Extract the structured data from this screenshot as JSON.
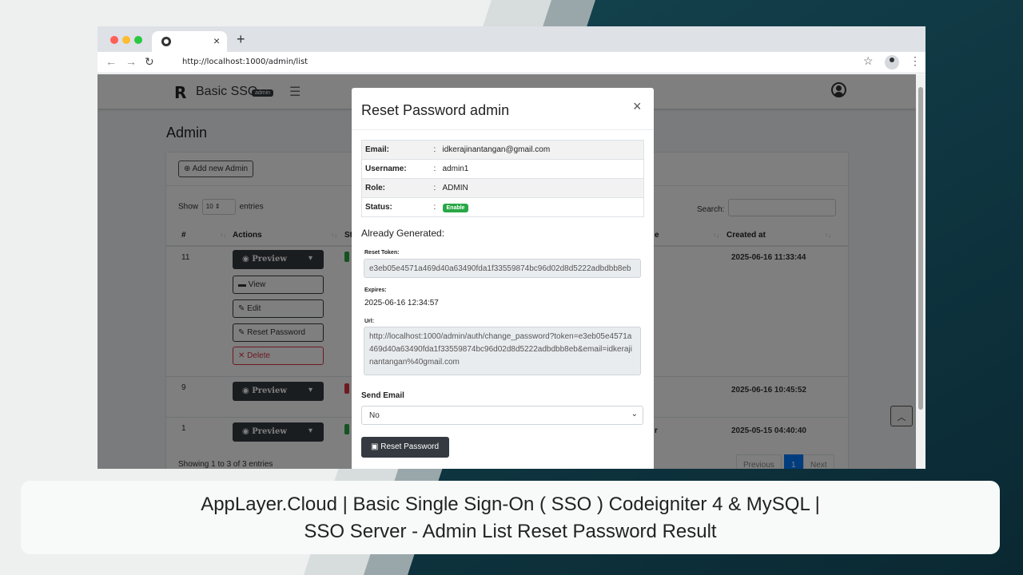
{
  "colors": {
    "accent": "#007bff",
    "dark_button": "#343a40",
    "success": "#28a745",
    "danger": "#dc3545"
  },
  "browser": {
    "url": "http://localhost:1000/admin/list",
    "tab_close": "×",
    "new_tab": "+",
    "icons": [
      "back-icon",
      "forward-icon",
      "reload-icon",
      "star-icon",
      "profile-icon",
      "menu-icon"
    ]
  },
  "app": {
    "brand_logo": "R",
    "brand": "Basic SSO",
    "brand_badge": "admin",
    "page_title": "Admin",
    "add_button": "Add new Admin",
    "show_label": "Show",
    "show_value": "10",
    "entries_label": "entries",
    "search_label": "Search:",
    "columns": {
      "num": "#",
      "actions": "Actions",
      "status_partial": "St",
      "created": "Created at"
    },
    "rows": [
      {
        "num": "11",
        "created": "2025-06-16 11:33:44"
      },
      {
        "num": "9",
        "created": "2025-06-16 10:45:52"
      },
      {
        "num": "1",
        "created": "2025-05-15 04:40:40",
        "partial": "r"
      }
    ],
    "actions": {
      "preview": "Preview",
      "view": "View",
      "edit": "Edit",
      "reset": "Reset Password",
      "delete": "Delete"
    },
    "showing": "Showing 1 to 3 of 3 entries",
    "pagination": {
      "prev": "Previous",
      "page": "1",
      "next": "Next"
    }
  },
  "modal": {
    "title": "Reset Password admin",
    "close": "×",
    "info": [
      {
        "key": "Email:",
        "value": "idkerajinantangan@gmail.com"
      },
      {
        "key": "Username:",
        "value": "admin1"
      },
      {
        "key": "Role:",
        "value": "ADMIN"
      },
      {
        "key": "Status:",
        "badge": "Enable"
      }
    ],
    "colon": ":",
    "generated_title": "Already Generated:",
    "token_label": "Reset Token:",
    "token_value": "e3eb05e4571a469d40a63490fda1f33559874bc96d02d8d5222adbdbb8eb",
    "expires_label": "Expires:",
    "expires_value": "2025-06-16 12:34:57",
    "url_label": "Url:",
    "url_value": "http://localhost:1000/admin/auth/change_password?token=e3eb05e4571a469d40a63490fda1f33559874bc96d02d8d5222adbdbb8eb&email=idkerajinantangan%40gmail.com",
    "send_label": "Send Email",
    "send_value": "No",
    "submit": "Reset Password"
  },
  "caption": {
    "line1": "AppLayer.Cloud | Basic Single Sign-On ( SSO ) Codeigniter 4 & MySQL |",
    "line2": "SSO Server - Admin List Reset Password Result"
  }
}
